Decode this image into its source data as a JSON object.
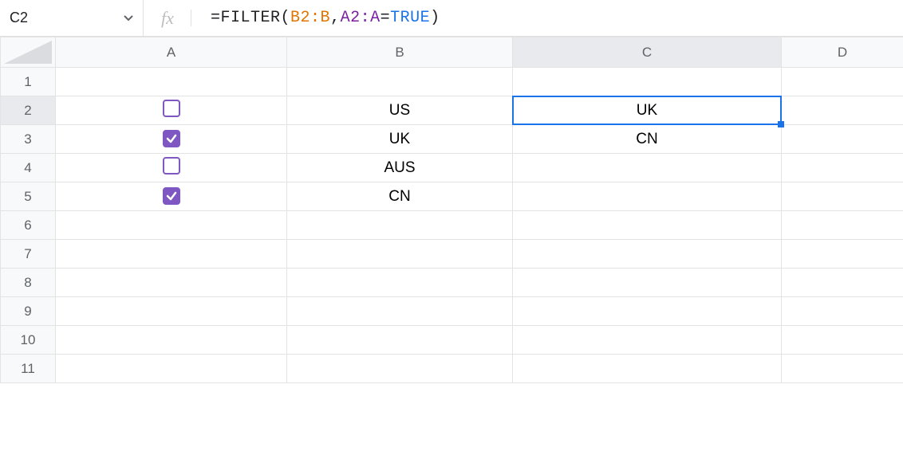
{
  "activeCell": "C2",
  "formula": {
    "eq": "=",
    "fn": "FILTER",
    "open": "(",
    "range1": "B2:B",
    "comma": ",",
    "range2": "A2:A",
    "eq2": "=",
    "bool": "TRUE",
    "close": ")"
  },
  "columns": [
    "A",
    "B",
    "C",
    "D"
  ],
  "rows": [
    "1",
    "2",
    "3",
    "4",
    "5",
    "6",
    "7",
    "8",
    "9",
    "10",
    "11"
  ],
  "cells": {
    "A2": {
      "checkbox": false
    },
    "A3": {
      "checkbox": true
    },
    "A4": {
      "checkbox": false
    },
    "A5": {
      "checkbox": true
    },
    "B2": "US",
    "B3": "UK",
    "B4": "AUS",
    "B5": "CN",
    "C2": "UK",
    "C3": "CN"
  },
  "activeColumn": "C",
  "activeRow": "2"
}
